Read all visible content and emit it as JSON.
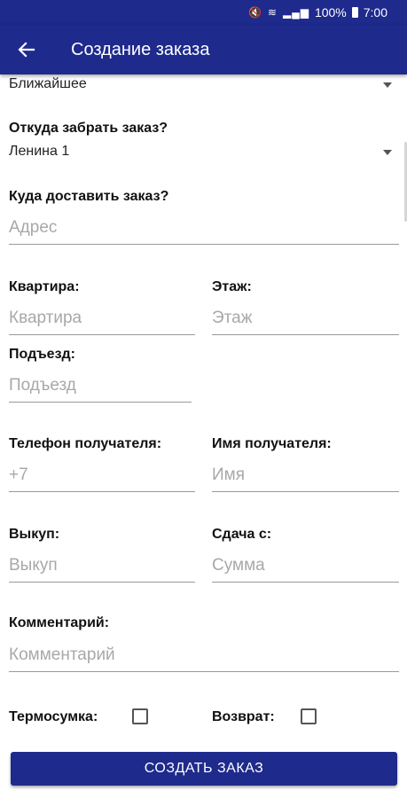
{
  "status_bar": {
    "icons": [
      "mute-icon",
      "wifi-icon",
      "lte-signal-icon",
      "battery-icon"
    ],
    "battery": "100%",
    "time": "7:00"
  },
  "app_bar": {
    "back_icon": "arrow-left-icon",
    "title": "Создание заказа"
  },
  "form": {
    "delivery_time": {
      "value": "Ближайшее"
    },
    "pickup": {
      "label": "Откуда забрать заказ?",
      "value": "Ленина 1"
    },
    "address": {
      "label": "Куда доставить заказ?",
      "placeholder": "Адрес"
    },
    "apartment": {
      "label": "Квартира:",
      "placeholder": "Квартира"
    },
    "floor": {
      "label": "Этаж:",
      "placeholder": "Этаж"
    },
    "entrance": {
      "label": "Подъезд:",
      "placeholder": "Подъезд"
    },
    "recipient_phone": {
      "label": "Телефон получателя:",
      "placeholder": "+7"
    },
    "recipient_name": {
      "label": "Имя получателя:",
      "placeholder": "Имя"
    },
    "buyout": {
      "label": "Выкуп:",
      "placeholder": "Выкуп"
    },
    "change_from": {
      "label": "Сдача с:",
      "placeholder": "Сумма"
    },
    "comment": {
      "label": "Комментарий:",
      "placeholder": "Комментарий"
    },
    "thermobag": {
      "label": "Термосумка:",
      "checked": false
    },
    "return": {
      "label": "Возврат:",
      "checked": false
    },
    "submit_label": "СОЗДАТЬ ЗАКАЗ"
  },
  "colors": {
    "primary": "#1e2a8c",
    "underline": "#9a9a9a",
    "placeholder": "#a8a8a8"
  }
}
